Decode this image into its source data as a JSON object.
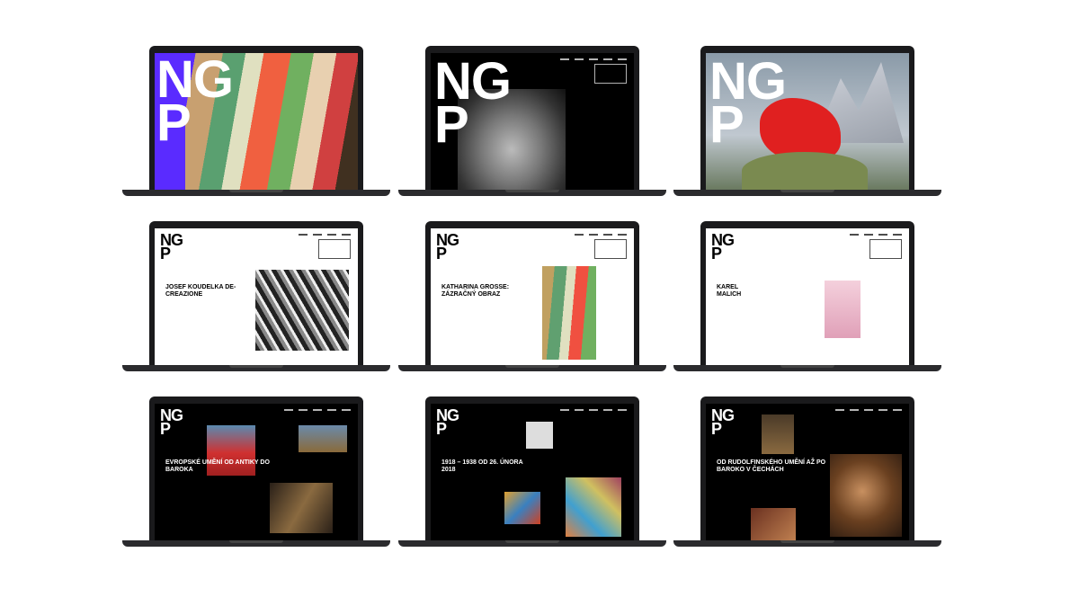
{
  "logo": {
    "line1": "NG",
    "line2": "P"
  },
  "screens": {
    "s4": {
      "title": "JOSEF KOUDELKA DE-CREAZIONE"
    },
    "s5": {
      "title": "KATHARINA GROSSE: ZÁZRAČNÝ OBRAZ"
    },
    "s6": {
      "title": "KAREL MALICH"
    },
    "s7": {
      "title": "EVROPSKÉ UMĚNÍ OD ANTIKY DO BAROKA"
    },
    "s8": {
      "title": "1918 – 1938 OD 26. ÚNORA 2018"
    },
    "s9": {
      "title": "OD RUDOLFINSKÉHO UMĚNÍ AŽ PO BAROKO V ČECHÁCH"
    }
  },
  "colors": {
    "accent": "#5a2bff",
    "dark": "#000000",
    "light": "#ffffff"
  }
}
